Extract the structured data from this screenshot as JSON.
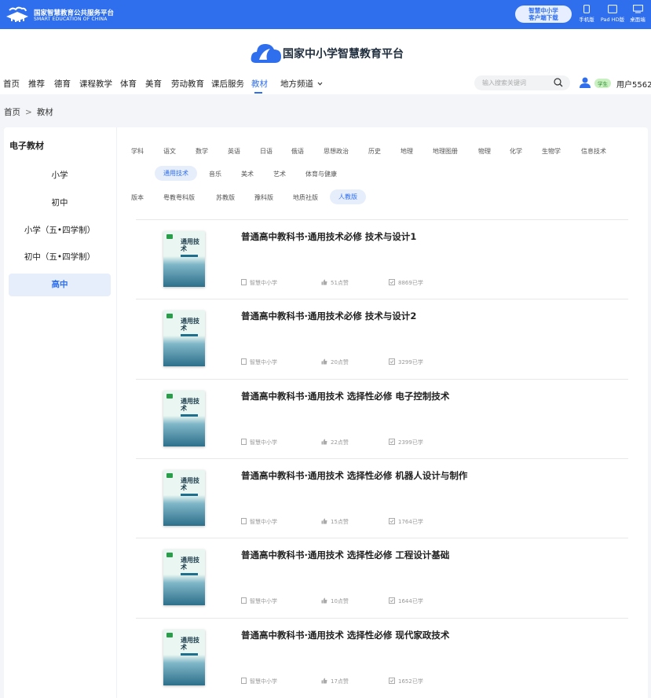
{
  "topbar": {
    "title_cn": "国家智慧教育公共服务平台",
    "title_en": "SMART EDUCATION OF CHINA",
    "download_line1": "智慧中小学",
    "download_line2": "客户端下载",
    "devices": [
      {
        "label": "手机版",
        "icon": "phone-icon"
      },
      {
        "label": "Pad HD版",
        "icon": "tablet-icon"
      },
      {
        "label": "桌面端",
        "icon": "desktop-icon"
      }
    ],
    "colors": {
      "bar": "#2f6fed"
    }
  },
  "brand": {
    "name": "国家中小学智慧教育平台"
  },
  "nav": {
    "items": [
      "首页",
      "推荐",
      "德育",
      "课程教学",
      "体育",
      "美育",
      "劳动教育",
      "课后服务",
      "教材",
      "地方频道"
    ],
    "active": "教材",
    "search_placeholder": "输入搜索关键词",
    "role_badge": "学生",
    "username": "用户5562"
  },
  "breadcrumb": {
    "home": "首页",
    "sep": ">",
    "current": "教材"
  },
  "sidebar": {
    "title": "电子教材",
    "items": [
      "小学",
      "初中",
      "小学（五•四学制）",
      "初中（五•四学制）",
      "高中"
    ],
    "active": "高中"
  },
  "filters": {
    "subject_label": "学科",
    "subjects_row1": [
      "语文",
      "数学",
      "英语",
      "日语",
      "俄语",
      "思想政治",
      "历史",
      "地理",
      "地理图册",
      "物理",
      "化学",
      "生物学",
      "信息技术"
    ],
    "subjects_row2": [
      "通用技术",
      "音乐",
      "美术",
      "艺术",
      "体育与健康"
    ],
    "subject_selected": "通用技术",
    "edition_label": "版本",
    "editions": [
      "粤教粤科版",
      "苏教版",
      "豫科版",
      "地质社版",
      "人教版"
    ],
    "edition_selected": "人教版"
  },
  "books": [
    {
      "title": "普通高中教科书·通用技术必修 技术与设计1",
      "publisher": "智慧中小学",
      "likes": "51点赞",
      "learners": "8869已学"
    },
    {
      "title": "普通高中教科书·通用技术必修 技术与设计2",
      "publisher": "智慧中小学",
      "likes": "20点赞",
      "learners": "3299已学"
    },
    {
      "title": "普通高中教科书·通用技术 选择性必修 电子控制技术",
      "publisher": "智慧中小学",
      "likes": "22点赞",
      "learners": "2399已学"
    },
    {
      "title": "普通高中教科书·通用技术 选择性必修 机器人设计与制作",
      "publisher": "智慧中小学",
      "likes": "15点赞",
      "learners": "1764已学"
    },
    {
      "title": "普通高中教科书·通用技术 选择性必修 工程设计基础",
      "publisher": "智慧中小学",
      "likes": "10点赞",
      "learners": "1644已学"
    },
    {
      "title": "普通高中教科书·通用技术 选择性必修 现代家政技术",
      "publisher": "智慧中小学",
      "likes": "17点赞",
      "learners": "1652已学"
    }
  ],
  "cover_text": "通用技术"
}
